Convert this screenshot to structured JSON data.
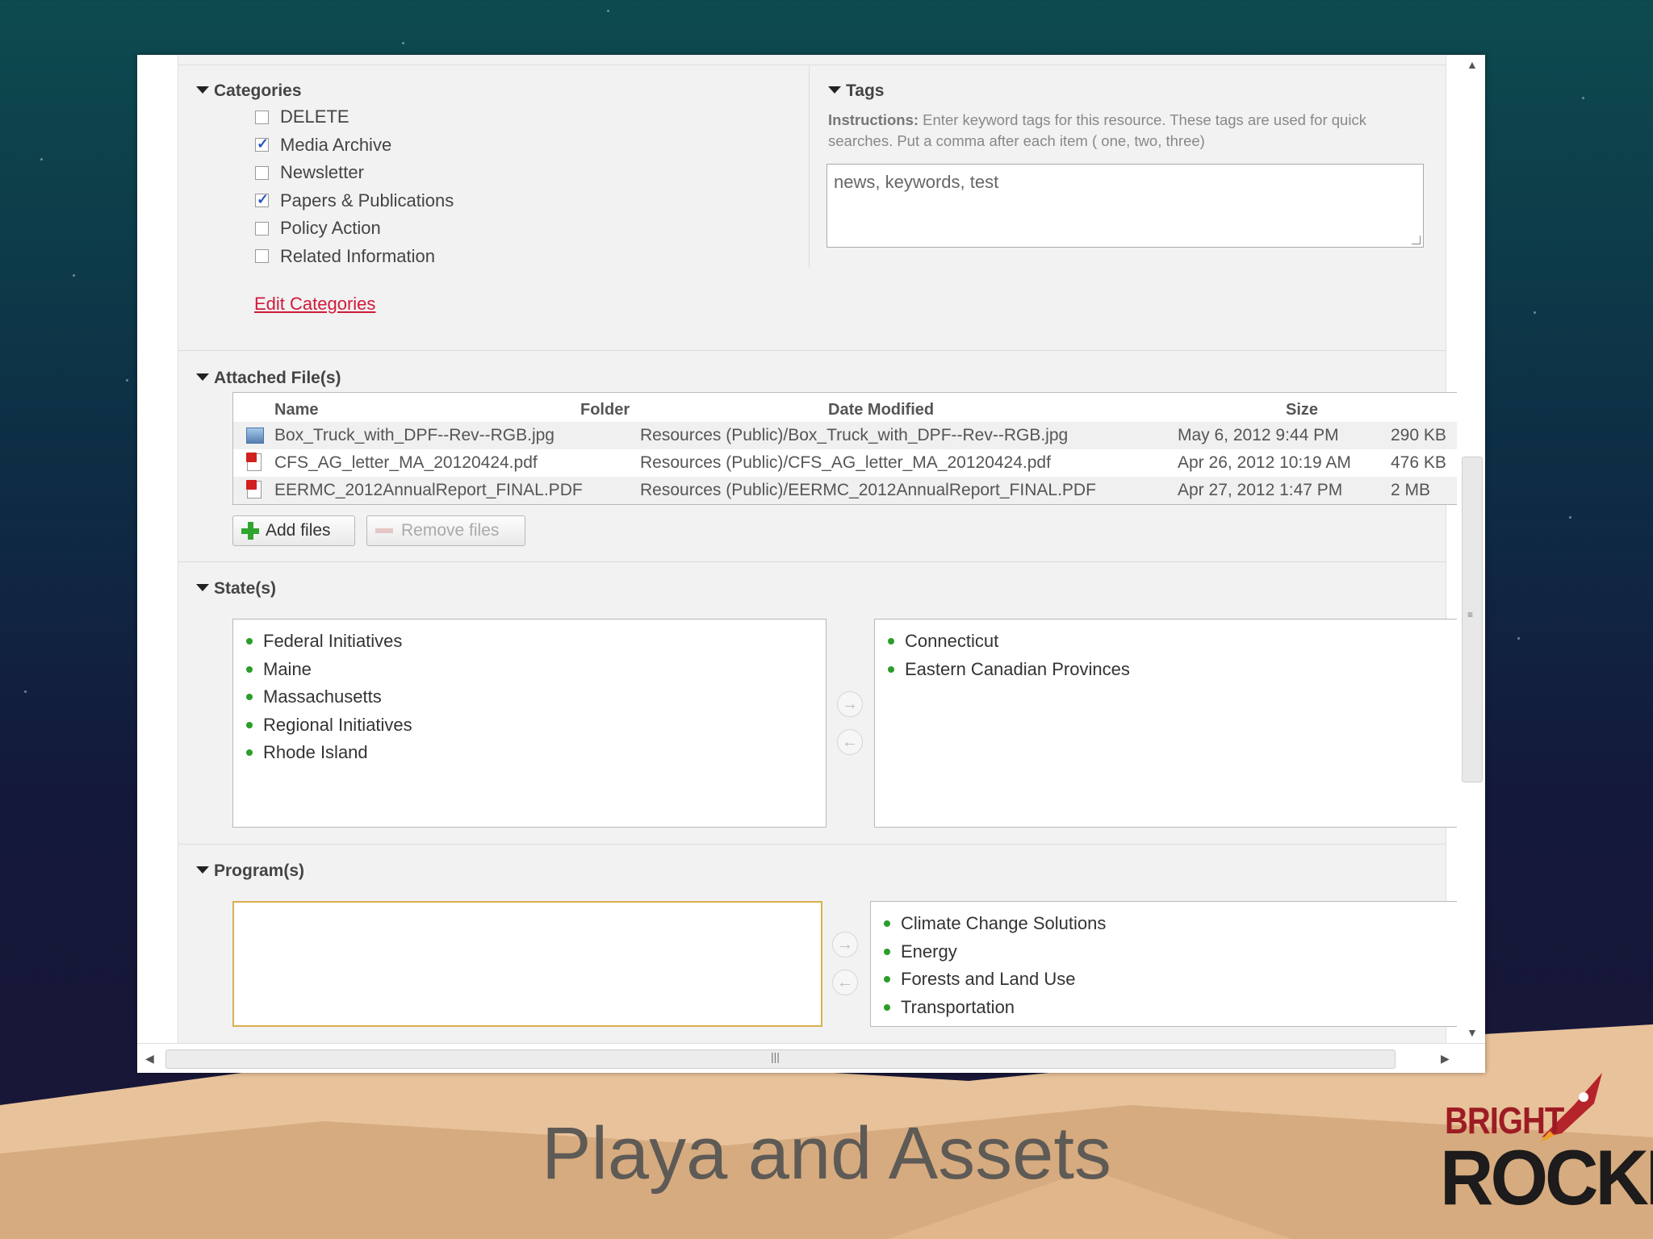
{
  "slide": {
    "title": "Playa and Assets"
  },
  "logo": {
    "line1": "BRIGHT",
    "line2": "ROCKET"
  },
  "categories": {
    "heading": "Categories",
    "items": [
      {
        "label": "DELETE",
        "checked": false
      },
      {
        "label": "Media Archive",
        "checked": true
      },
      {
        "label": "Newsletter",
        "checked": false
      },
      {
        "label": "Papers & Publications",
        "checked": true
      },
      {
        "label": "Policy Action",
        "checked": false
      },
      {
        "label": "Related Information",
        "checked": false
      }
    ],
    "edit_link": "Edit Categories"
  },
  "tags": {
    "heading": "Tags",
    "instructions_label": "Instructions:",
    "instructions_text": "Enter keyword tags for this resource. These tags are used for quick searches. Put a comma after each item ( one, two, three)",
    "value": "news, keywords, test"
  },
  "files": {
    "heading": "Attached File(s)",
    "columns": {
      "name": "Name",
      "folder": "Folder",
      "date": "Date Modified",
      "size": "Size"
    },
    "rows": [
      {
        "icon": "image-file-icon",
        "name": "Box_Truck_with_DPF--Rev--RGB.jpg",
        "folder": "Resources (Public)/Box_Truck_with_DPF--Rev--RGB.jpg",
        "date": "May 6, 2012 9:44 PM",
        "size": "290 KB"
      },
      {
        "icon": "pdf-file-icon",
        "name": "CFS_AG_letter_MA_20120424.pdf",
        "folder": "Resources (Public)/CFS_AG_letter_MA_20120424.pdf",
        "date": "Apr 26, 2012 10:19 AM",
        "size": "476 KB"
      },
      {
        "icon": "pdf-file-icon",
        "name": "EERMC_2012AnnualReport_FINAL.PDF",
        "folder": "Resources (Public)/EERMC_2012AnnualReport_FINAL.PDF",
        "date": "Apr 27, 2012 1:47 PM",
        "size": "2 MB"
      }
    ],
    "add_label": "Add files",
    "remove_label": "Remove files"
  },
  "states": {
    "heading": "State(s)",
    "available": [
      "Federal Initiatives",
      "Maine",
      "Massachusetts",
      "Regional Initiatives",
      "Rhode Island"
    ],
    "selected": [
      "Connecticut",
      "Eastern Canadian Provinces"
    ]
  },
  "programs": {
    "heading": "Program(s)",
    "available": [],
    "selected": [
      "Climate Change Solutions",
      "Energy",
      "Forests and Land Use",
      "Transportation"
    ]
  },
  "colors": {
    "link": "#d11a3b",
    "bullet": "#2a9d2a",
    "focus_border": "#d9b04f"
  }
}
